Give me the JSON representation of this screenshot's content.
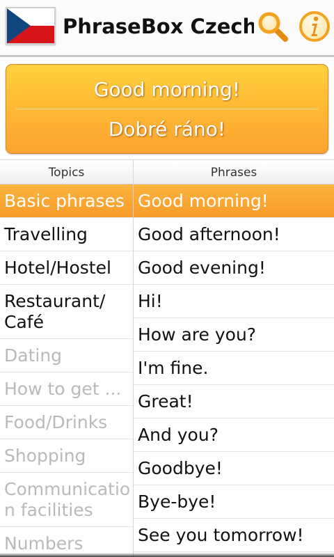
{
  "header": {
    "title": "PhraseBox Czech...",
    "icons": {
      "flag": "czech-flag-icon",
      "search": "search-icon",
      "info": "info-icon"
    },
    "colors": {
      "flag_blue": "#11457e",
      "flag_red": "#d7141a",
      "icon_orange": "#f6a623"
    }
  },
  "phrase_card": {
    "english": "Good morning!",
    "czech": "Dobré ráno!",
    "colors": {
      "gradient_top": "#ffd13f",
      "gradient_bottom": "#fca431"
    }
  },
  "topics": {
    "header": "Topics",
    "items": [
      {
        "label": "Basic phrases",
        "state": "selected"
      },
      {
        "label": "Travelling",
        "state": "enabled"
      },
      {
        "label": "Hotel/Hostel",
        "state": "enabled"
      },
      {
        "label": "Restaurant/ Café",
        "state": "enabled"
      },
      {
        "label": "Dating",
        "state": "disabled"
      },
      {
        "label": "How to get ...",
        "state": "disabled"
      },
      {
        "label": "Food/Drinks",
        "state": "disabled"
      },
      {
        "label": "Shopping",
        "state": "disabled"
      },
      {
        "label": "Communicatio n facilities",
        "state": "disabled"
      },
      {
        "label": "Numbers",
        "state": "disabled"
      }
    ]
  },
  "phrases": {
    "header": "Phrases",
    "items": [
      {
        "label": "Good morning!",
        "state": "selected"
      },
      {
        "label": "Good afternoon!",
        "state": "enabled"
      },
      {
        "label": "Good evening!",
        "state": "enabled"
      },
      {
        "label": "Hi!",
        "state": "enabled"
      },
      {
        "label": "How are you?",
        "state": "enabled"
      },
      {
        "label": "I'm fine.",
        "state": "enabled"
      },
      {
        "label": "Great!",
        "state": "enabled"
      },
      {
        "label": "And you?",
        "state": "enabled"
      },
      {
        "label": "Goodbye!",
        "state": "enabled"
      },
      {
        "label": "Bye-bye!",
        "state": "enabled"
      },
      {
        "label": "See you tomorrow!",
        "state": "enabled"
      }
    ]
  },
  "colors": {
    "selection": "#f79a28",
    "disabled_text": "#b9b9b9"
  }
}
